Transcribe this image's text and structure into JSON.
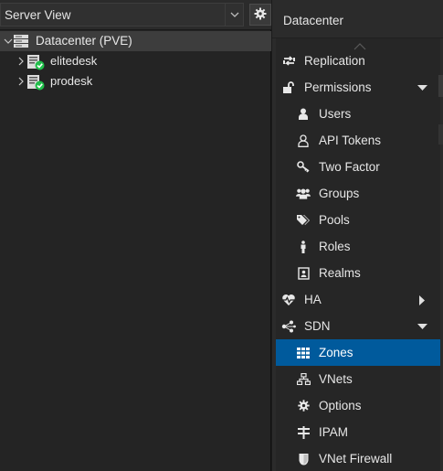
{
  "left": {
    "view_selector": {
      "value": "Server View"
    },
    "tree": {
      "root": {
        "label": "Datacenter (PVE)"
      },
      "nodes": [
        {
          "label": "elitedesk",
          "status": "online"
        },
        {
          "label": "prodesk",
          "status": "online"
        }
      ]
    }
  },
  "right": {
    "header": {
      "title": "Datacenter"
    },
    "menu": [
      {
        "label": "Replication",
        "icon": "replication-icon",
        "level": 0
      },
      {
        "label": "Permissions",
        "icon": "unlock-icon",
        "level": 0,
        "expander": "expanded"
      },
      {
        "label": "Users",
        "icon": "user-icon",
        "level": 1
      },
      {
        "label": "API Tokens",
        "icon": "api-token-icon",
        "level": 1
      },
      {
        "label": "Two Factor",
        "icon": "key-icon",
        "level": 1
      },
      {
        "label": "Groups",
        "icon": "group-icon",
        "level": 1
      },
      {
        "label": "Pools",
        "icon": "tags-icon",
        "level": 1
      },
      {
        "label": "Roles",
        "icon": "male-icon",
        "level": 1
      },
      {
        "label": "Realms",
        "icon": "address-book-icon",
        "level": 1
      },
      {
        "label": "HA",
        "icon": "heartbeat-icon",
        "level": 0,
        "expander": "collapsed"
      },
      {
        "label": "SDN",
        "icon": "sdn-icon",
        "level": 0,
        "expander": "expanded"
      },
      {
        "label": "Zones",
        "icon": "grid-icon",
        "level": 1,
        "active": true
      },
      {
        "label": "VNets",
        "icon": "network-icon",
        "level": 1
      },
      {
        "label": "Options",
        "icon": "gear-icon",
        "level": 1
      },
      {
        "label": "IPAM",
        "icon": "ipam-icon",
        "level": 1
      },
      {
        "label": "VNet Firewall",
        "icon": "shield-icon",
        "level": 1
      }
    ]
  },
  "colors": {
    "accent": "#005a9c",
    "status_ok": "#21bf4b"
  }
}
